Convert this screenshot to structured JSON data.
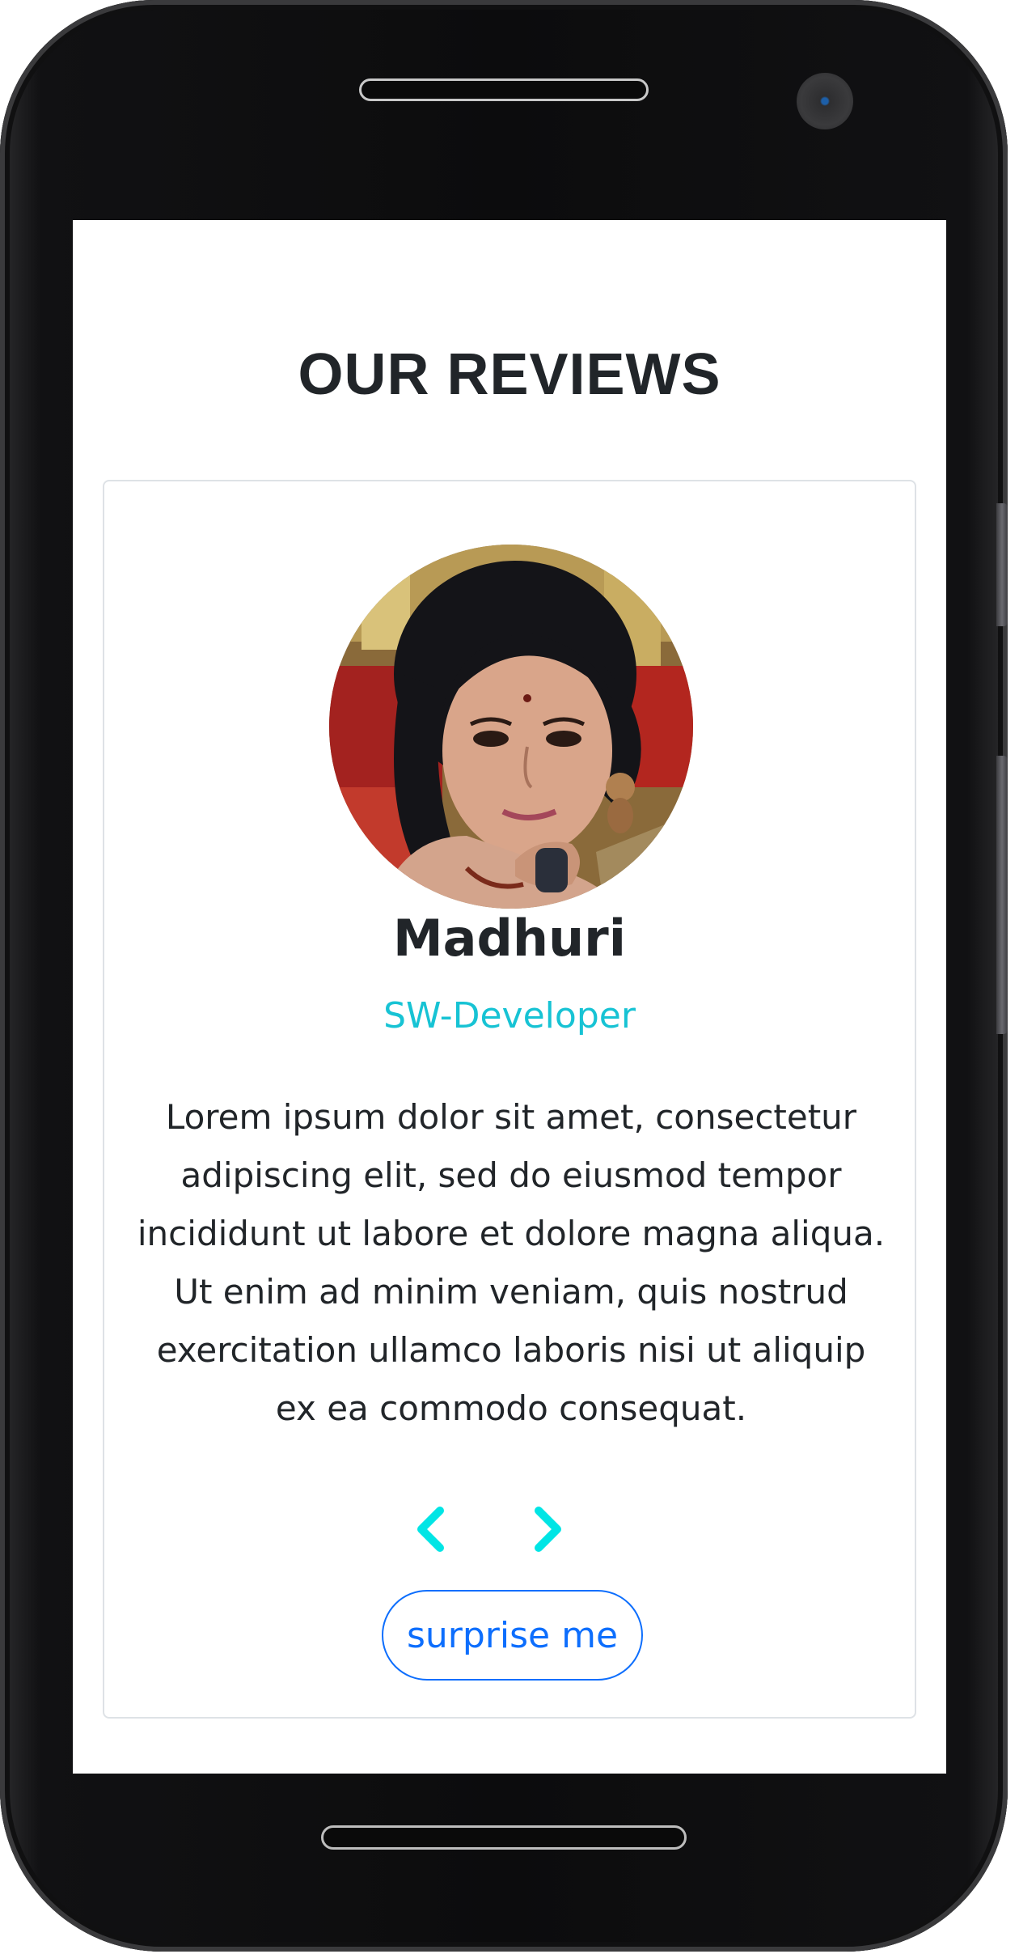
{
  "page": {
    "title": "OUR REVIEWS"
  },
  "review": {
    "author": "Madhuri",
    "job": "SW-Developer",
    "text": "Lorem ipsum dolor sit amet, consectetur adipiscing elit, sed do eiusmod tempor incididunt ut labore et dolore magna aliqua. Ut enim ad minim veniam, quis nostrud exercitation ullamco laboris nisi ut aliquip ex ea commodo consequat.",
    "image_alt": "Madhuri"
  },
  "controls": {
    "prev_icon": "chevron-left-icon",
    "next_icon": "chevron-right-icon",
    "random_label": "surprise me"
  },
  "colors": {
    "job": "#17c3d4",
    "chevron": "#00e5e5",
    "button": "#0d6efd",
    "heading": "#212529"
  }
}
